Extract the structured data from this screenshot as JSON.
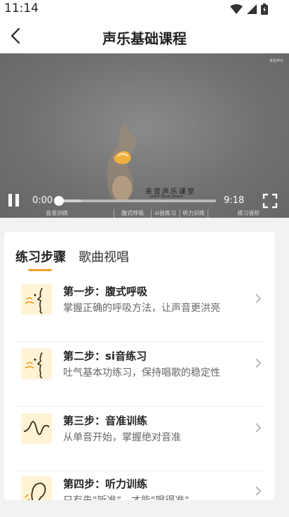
{
  "status_bar": {
    "time": "11:14"
  },
  "header": {
    "title": "声乐基础课程"
  },
  "video": {
    "brand_cn": "来音声乐课堂",
    "brand_en": "Laiyin Vocal Lesson",
    "watermark": "来音声乐",
    "current_time": "0:00",
    "duration": "9:18",
    "progress": 0,
    "buffered": 0.15,
    "chapters": [
      "音准训练",
      "腹式呼吸",
      "si音练习",
      "听力训练",
      "练习音阶"
    ]
  },
  "tabs": [
    "练习步骤",
    "歌曲视唱"
  ],
  "lessons": [
    {
      "title": "第一步：腹式呼吸",
      "desc": "掌握正确的呼吸方法，让声音更洪亮",
      "icon": "breathing-face-icon"
    },
    {
      "title": "第二步：si音练习",
      "desc": "吐气基本功练习，保持唱歌的稳定性",
      "icon": "breathing-face-icon"
    },
    {
      "title": "第三步：音准训练",
      "desc": "从单音开始，掌握绝对音准",
      "icon": "waveform-icon"
    },
    {
      "title": "第四步：听力训练",
      "desc": "只有先\"听准\"，才能\"唱得准\"",
      "icon": "ear-icon"
    }
  ]
}
